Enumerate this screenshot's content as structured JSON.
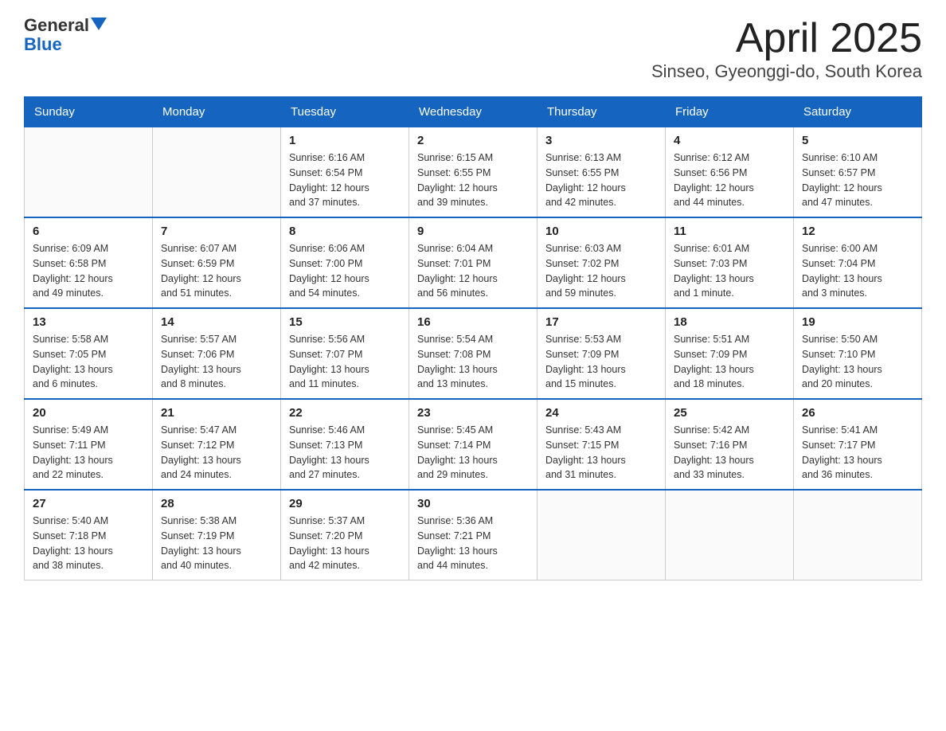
{
  "header": {
    "logo_text_general": "General",
    "logo_text_blue": "Blue",
    "title": "April 2025",
    "subtitle": "Sinseo, Gyeonggi-do, South Korea"
  },
  "calendar": {
    "days_of_week": [
      "Sunday",
      "Monday",
      "Tuesday",
      "Wednesday",
      "Thursday",
      "Friday",
      "Saturday"
    ],
    "weeks": [
      [
        {
          "day": "",
          "info": ""
        },
        {
          "day": "",
          "info": ""
        },
        {
          "day": "1",
          "info": "Sunrise: 6:16 AM\nSunset: 6:54 PM\nDaylight: 12 hours\nand 37 minutes."
        },
        {
          "day": "2",
          "info": "Sunrise: 6:15 AM\nSunset: 6:55 PM\nDaylight: 12 hours\nand 39 minutes."
        },
        {
          "day": "3",
          "info": "Sunrise: 6:13 AM\nSunset: 6:55 PM\nDaylight: 12 hours\nand 42 minutes."
        },
        {
          "day": "4",
          "info": "Sunrise: 6:12 AM\nSunset: 6:56 PM\nDaylight: 12 hours\nand 44 minutes."
        },
        {
          "day": "5",
          "info": "Sunrise: 6:10 AM\nSunset: 6:57 PM\nDaylight: 12 hours\nand 47 minutes."
        }
      ],
      [
        {
          "day": "6",
          "info": "Sunrise: 6:09 AM\nSunset: 6:58 PM\nDaylight: 12 hours\nand 49 minutes."
        },
        {
          "day": "7",
          "info": "Sunrise: 6:07 AM\nSunset: 6:59 PM\nDaylight: 12 hours\nand 51 minutes."
        },
        {
          "day": "8",
          "info": "Sunrise: 6:06 AM\nSunset: 7:00 PM\nDaylight: 12 hours\nand 54 minutes."
        },
        {
          "day": "9",
          "info": "Sunrise: 6:04 AM\nSunset: 7:01 PM\nDaylight: 12 hours\nand 56 minutes."
        },
        {
          "day": "10",
          "info": "Sunrise: 6:03 AM\nSunset: 7:02 PM\nDaylight: 12 hours\nand 59 minutes."
        },
        {
          "day": "11",
          "info": "Sunrise: 6:01 AM\nSunset: 7:03 PM\nDaylight: 13 hours\nand 1 minute."
        },
        {
          "day": "12",
          "info": "Sunrise: 6:00 AM\nSunset: 7:04 PM\nDaylight: 13 hours\nand 3 minutes."
        }
      ],
      [
        {
          "day": "13",
          "info": "Sunrise: 5:58 AM\nSunset: 7:05 PM\nDaylight: 13 hours\nand 6 minutes."
        },
        {
          "day": "14",
          "info": "Sunrise: 5:57 AM\nSunset: 7:06 PM\nDaylight: 13 hours\nand 8 minutes."
        },
        {
          "day": "15",
          "info": "Sunrise: 5:56 AM\nSunset: 7:07 PM\nDaylight: 13 hours\nand 11 minutes."
        },
        {
          "day": "16",
          "info": "Sunrise: 5:54 AM\nSunset: 7:08 PM\nDaylight: 13 hours\nand 13 minutes."
        },
        {
          "day": "17",
          "info": "Sunrise: 5:53 AM\nSunset: 7:09 PM\nDaylight: 13 hours\nand 15 minutes."
        },
        {
          "day": "18",
          "info": "Sunrise: 5:51 AM\nSunset: 7:09 PM\nDaylight: 13 hours\nand 18 minutes."
        },
        {
          "day": "19",
          "info": "Sunrise: 5:50 AM\nSunset: 7:10 PM\nDaylight: 13 hours\nand 20 minutes."
        }
      ],
      [
        {
          "day": "20",
          "info": "Sunrise: 5:49 AM\nSunset: 7:11 PM\nDaylight: 13 hours\nand 22 minutes."
        },
        {
          "day": "21",
          "info": "Sunrise: 5:47 AM\nSunset: 7:12 PM\nDaylight: 13 hours\nand 24 minutes."
        },
        {
          "day": "22",
          "info": "Sunrise: 5:46 AM\nSunset: 7:13 PM\nDaylight: 13 hours\nand 27 minutes."
        },
        {
          "day": "23",
          "info": "Sunrise: 5:45 AM\nSunset: 7:14 PM\nDaylight: 13 hours\nand 29 minutes."
        },
        {
          "day": "24",
          "info": "Sunrise: 5:43 AM\nSunset: 7:15 PM\nDaylight: 13 hours\nand 31 minutes."
        },
        {
          "day": "25",
          "info": "Sunrise: 5:42 AM\nSunset: 7:16 PM\nDaylight: 13 hours\nand 33 minutes."
        },
        {
          "day": "26",
          "info": "Sunrise: 5:41 AM\nSunset: 7:17 PM\nDaylight: 13 hours\nand 36 minutes."
        }
      ],
      [
        {
          "day": "27",
          "info": "Sunrise: 5:40 AM\nSunset: 7:18 PM\nDaylight: 13 hours\nand 38 minutes."
        },
        {
          "day": "28",
          "info": "Sunrise: 5:38 AM\nSunset: 7:19 PM\nDaylight: 13 hours\nand 40 minutes."
        },
        {
          "day": "29",
          "info": "Sunrise: 5:37 AM\nSunset: 7:20 PM\nDaylight: 13 hours\nand 42 minutes."
        },
        {
          "day": "30",
          "info": "Sunrise: 5:36 AM\nSunset: 7:21 PM\nDaylight: 13 hours\nand 44 minutes."
        },
        {
          "day": "",
          "info": ""
        },
        {
          "day": "",
          "info": ""
        },
        {
          "day": "",
          "info": ""
        }
      ]
    ]
  }
}
